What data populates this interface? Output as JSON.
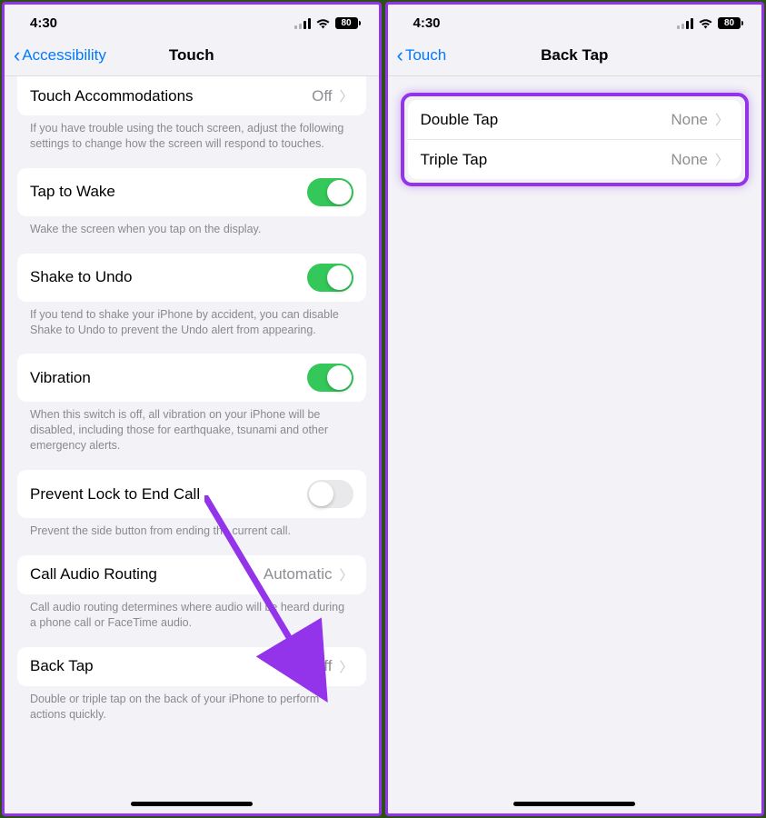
{
  "status": {
    "time": "4:30",
    "battery": "80"
  },
  "left": {
    "back": "Accessibility",
    "title": "Touch",
    "touchAccommodations": {
      "label": "Touch Accommodations",
      "value": "Off"
    },
    "touchAccommodationsFooter": "If you have trouble using the touch screen, adjust the following settings to change how the screen will respond to touches.",
    "tapToWake": {
      "label": "Tap to Wake",
      "on": true
    },
    "tapToWakeFooter": "Wake the screen when you tap on the display.",
    "shakeToUndo": {
      "label": "Shake to Undo",
      "on": true
    },
    "shakeToUndoFooter": "If you tend to shake your iPhone by accident, you can disable Shake to Undo to prevent the Undo alert from appearing.",
    "vibration": {
      "label": "Vibration",
      "on": true
    },
    "vibrationFooter": "When this switch is off, all vibration on your iPhone will be disabled, including those for earthquake, tsunami and other emergency alerts.",
    "preventLock": {
      "label": "Prevent Lock to End Call",
      "on": false
    },
    "preventLockFooter": "Prevent the side button from ending the current call.",
    "callAudioRouting": {
      "label": "Call Audio Routing",
      "value": "Automatic"
    },
    "callAudioRoutingFooter": "Call audio routing determines where audio will be heard during a phone call or FaceTime audio.",
    "backTap": {
      "label": "Back Tap",
      "value": "Off"
    },
    "backTapFooter": "Double or triple tap on the back of your iPhone to perform actions quickly."
  },
  "right": {
    "back": "Touch",
    "title": "Back Tap",
    "doubleTap": {
      "label": "Double Tap",
      "value": "None"
    },
    "tripleTap": {
      "label": "Triple Tap",
      "value": "None"
    }
  }
}
